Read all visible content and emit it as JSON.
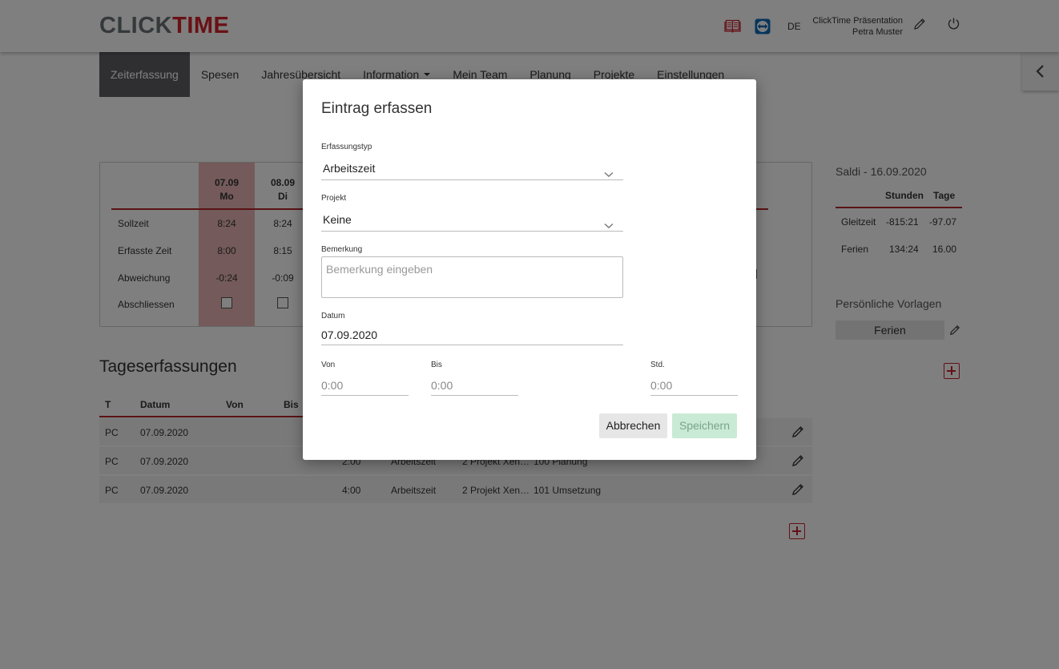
{
  "header": {
    "logo_part1": "CLICK",
    "logo_part2": "TIME",
    "language": "DE",
    "account": "ClickTime Präsentation",
    "user": "Petra Muster",
    "icons": [
      "help-book-icon",
      "teamviewer-icon",
      "edit-pencil-icon",
      "power-icon",
      "chevron-left-icon"
    ]
  },
  "nav": {
    "items": [
      {
        "label": "Zeiterfassung"
      },
      {
        "label": "Spesen"
      },
      {
        "label": "Jahresübersicht"
      },
      {
        "label": "Information"
      },
      {
        "label": "Mein Team"
      },
      {
        "label": "Planung"
      },
      {
        "label": "Projekte"
      },
      {
        "label": "Einstellungen"
      }
    ]
  },
  "week": {
    "rows": [
      "Sollzeit",
      "Erfasste Zeit",
      "Abweichung",
      "Abschliessen"
    ],
    "days": [
      {
        "date": "07.09",
        "day": "Mo",
        "soll": "8:24",
        "erfasst": "8:00",
        "abweichung": "-0:24"
      },
      {
        "date": "08.09",
        "day": "Di",
        "soll": "8:24",
        "erfasst": "8:15",
        "abweichung": "-0:09"
      }
    ],
    "partial_text": "020"
  },
  "saldi": {
    "title": "Saldi - 16.09.2020",
    "col_hours": "Stunden",
    "col_days": "Tage",
    "rows": [
      {
        "label": "Gleitzeit",
        "hours": "-815:21",
        "days": "-97.07"
      },
      {
        "label": "Ferien",
        "hours": "134:24",
        "days": "16.00"
      }
    ]
  },
  "vorlagen": {
    "title": "Persönliche Vorlagen",
    "button": "Ferien"
  },
  "entries": {
    "title": "Tageserfassungen",
    "headers": {
      "t": "T",
      "datum": "Datum",
      "von": "Von",
      "bis": "Bis"
    },
    "rows": [
      {
        "t": "PC",
        "datum": "07.09.2020",
        "std": "",
        "typ": "",
        "projekt": "",
        "task": ""
      },
      {
        "t": "PC",
        "datum": "07.09.2020",
        "std": "2:00",
        "typ": "Arbeitszeit",
        "projekt": "2 Projekt Xen…",
        "task": "100 Planung"
      },
      {
        "t": "PC",
        "datum": "07.09.2020",
        "std": "4:00",
        "typ": "Arbeitszeit",
        "projekt": "2 Projekt Xen…",
        "task": "101 Umsetzung"
      }
    ]
  },
  "modal": {
    "title": "Eintrag erfassen",
    "type_label": "Erfassungstyp",
    "type_value": "Arbeitszeit",
    "project_label": "Projekt",
    "project_value": "Keine",
    "remark_label": "Bemerkung",
    "remark_placeholder": "Bemerkung eingeben",
    "date_label": "Datum",
    "date_value": "07.09.2020",
    "from_label": "Von",
    "from_placeholder": "0:00",
    "to_label": "Bis",
    "to_placeholder": "0:00",
    "hours_label": "Std.",
    "hours_placeholder": "0:00",
    "cancel": "Abbrechen",
    "save": "Speichern"
  },
  "colors": {
    "brand_red": "#d2232a",
    "accent_line": "#b5262b",
    "nav_active": "#5f5f63",
    "day_highlight": "#e8b4b4",
    "save_disabled": "#c9ead5"
  }
}
